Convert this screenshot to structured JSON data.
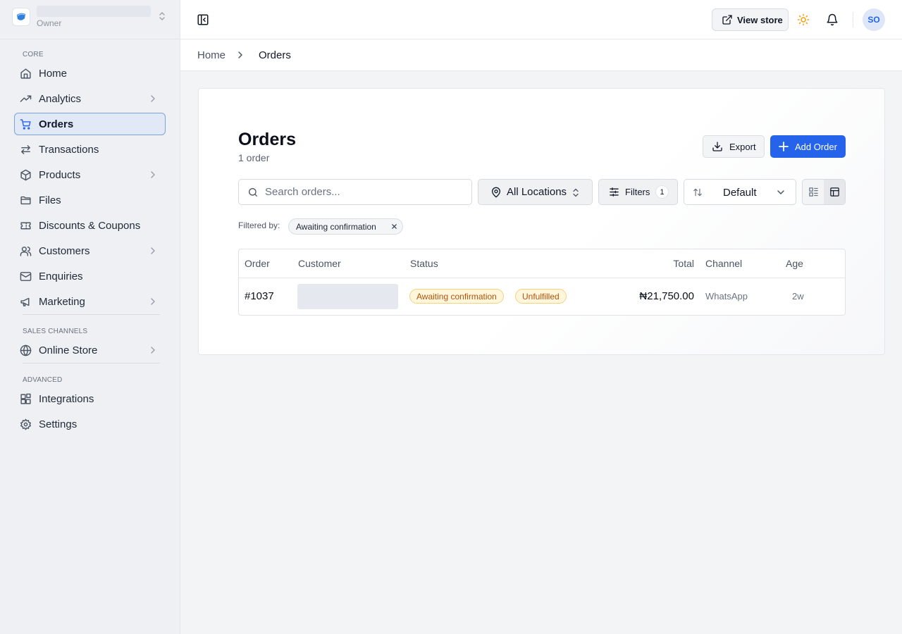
{
  "sidebar": {
    "store": {
      "role": "Owner"
    },
    "sections": [
      {
        "label": "CORE"
      },
      {
        "label": "SALES CHANNELS"
      },
      {
        "label": "ADVANCED"
      }
    ],
    "items": [
      {
        "label": "Home",
        "icon": "home-icon"
      },
      {
        "label": "Analytics",
        "icon": "analytics-icon",
        "has_children": true
      },
      {
        "label": "Orders",
        "icon": "cart-icon",
        "active": true
      },
      {
        "label": "Transactions",
        "icon": "transfer-icon"
      },
      {
        "label": "Products",
        "icon": "box-icon",
        "has_children": true
      },
      {
        "label": "Files",
        "icon": "folder-icon"
      },
      {
        "label": "Discounts & Coupons",
        "icon": "ticket-icon"
      },
      {
        "label": "Customers",
        "icon": "users-icon",
        "has_children": true
      },
      {
        "label": "Enquiries",
        "icon": "mail-icon"
      },
      {
        "label": "Marketing",
        "icon": "megaphone-icon",
        "has_children": true
      },
      {
        "label": "Online Store",
        "icon": "globe-icon",
        "has_children": true
      },
      {
        "label": "Integrations",
        "icon": "blocks-icon"
      },
      {
        "label": "Settings",
        "icon": "gear-icon"
      }
    ]
  },
  "topbar": {
    "view_store_label": "View store",
    "avatar_initials": "SO"
  },
  "breadcrumb": [
    "Home",
    "Orders"
  ],
  "main": {
    "title": "Orders",
    "subtitle": "1 order",
    "export_label": "Export",
    "add_label": "Add Order",
    "search_placeholder": "Search orders...",
    "location_value": "All Locations",
    "filters_label": "Filters",
    "filters_count": "1",
    "sort_value": "Default",
    "filtered_by_label": "Filtered by:",
    "active_filter": "Awaiting confirmation"
  },
  "table": {
    "columns": [
      "Order",
      "Customer",
      "Status",
      "Total",
      "Channel",
      "Age"
    ],
    "rows": [
      {
        "order": "#1037",
        "statuses": [
          "Awaiting confirmation",
          "Unfulfilled"
        ],
        "total": "₦21,750.00",
        "channel": "WhatsApp",
        "age": "2w"
      }
    ]
  },
  "colors": {
    "accent": "#2563eb",
    "active_nav_bg": "#e1e9f7",
    "status_badge_bg": "#fff6dc",
    "status_badge_text": "#b45309",
    "theme_icon": "#f59e0b"
  }
}
